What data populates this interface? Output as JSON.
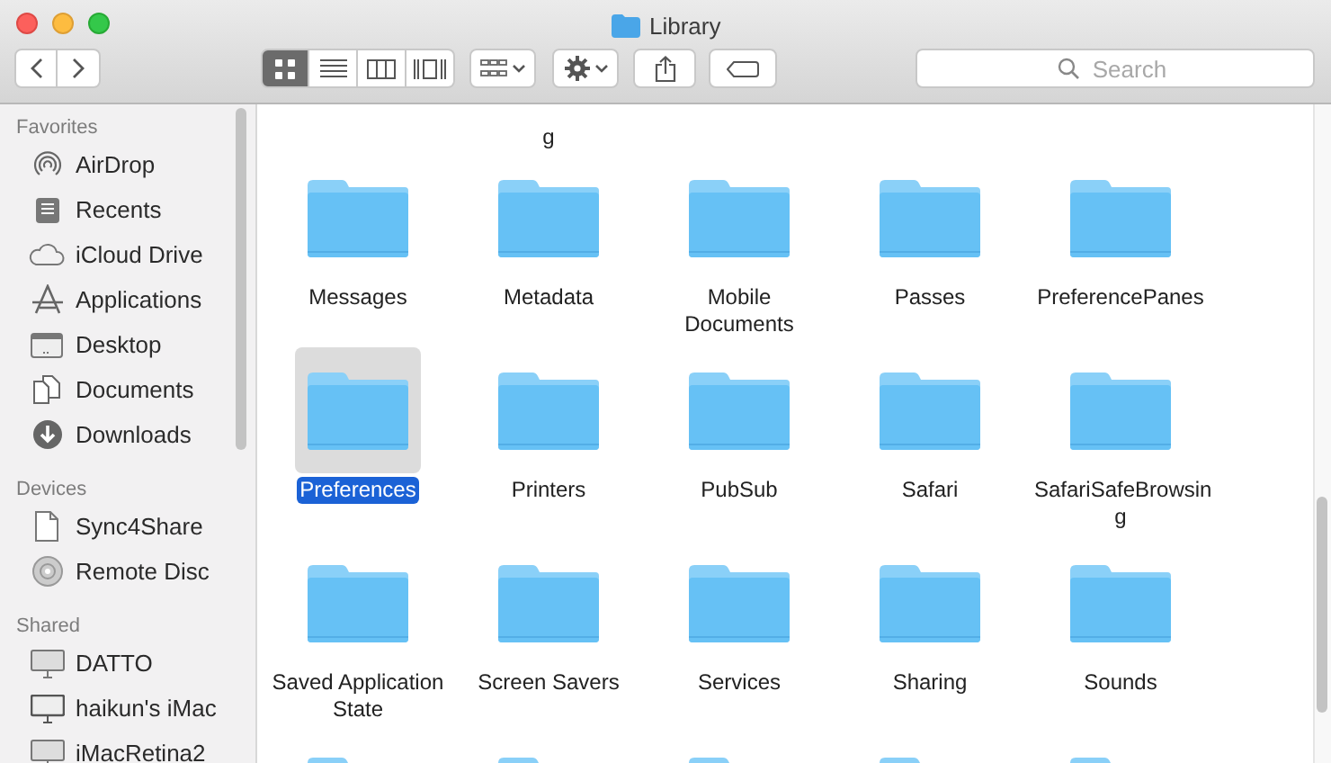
{
  "window": {
    "title": "Library"
  },
  "toolbar": {
    "view_modes": [
      {
        "kind": "icons",
        "selected": true
      },
      {
        "kind": "list",
        "selected": false
      },
      {
        "kind": "columns",
        "selected": false
      },
      {
        "kind": "gallery",
        "selected": false
      }
    ],
    "search": {
      "placeholder": "Search"
    }
  },
  "sidebar": {
    "sections": [
      {
        "title": "Favorites",
        "items": [
          {
            "label": "AirDrop",
            "kind": "airdrop"
          },
          {
            "label": "Recents",
            "kind": "recents"
          },
          {
            "label": "iCloud Drive",
            "kind": "cloud"
          },
          {
            "label": "Applications",
            "kind": "apps"
          },
          {
            "label": "Desktop",
            "kind": "desktop"
          },
          {
            "label": "Documents",
            "kind": "documents"
          },
          {
            "label": "Downloads",
            "kind": "downloads"
          }
        ]
      },
      {
        "title": "Devices",
        "items": [
          {
            "label": "Sync4Share",
            "kind": "file"
          },
          {
            "label": "Remote Disc",
            "kind": "disc"
          }
        ]
      },
      {
        "title": "Shared",
        "items": [
          {
            "label": "DATTO",
            "kind": "computer"
          },
          {
            "label": "haikun's iMac",
            "kind": "imac"
          },
          {
            "label": "iMacRetina2",
            "kind": "computer"
          }
        ]
      }
    ]
  },
  "grid": {
    "clipped_row_label": "g",
    "items": [
      {
        "label": "Messages",
        "selected": false
      },
      {
        "label": "Metadata",
        "selected": false
      },
      {
        "label": "Mobile Documents",
        "selected": false
      },
      {
        "label": "Passes",
        "selected": false
      },
      {
        "label": "PreferencePanes",
        "selected": false
      },
      {
        "label": "Preferences",
        "selected": true
      },
      {
        "label": "Printers",
        "selected": false
      },
      {
        "label": "PubSub",
        "selected": false
      },
      {
        "label": "Safari",
        "selected": false
      },
      {
        "label": "SafariSafeBrowsin g",
        "selected": false
      },
      {
        "label": "Saved Application State",
        "selected": false
      },
      {
        "label": "Screen Savers",
        "selected": false
      },
      {
        "label": "Services",
        "selected": false
      },
      {
        "label": "Sharing",
        "selected": false
      },
      {
        "label": "Sounds",
        "selected": false
      }
    ]
  }
}
